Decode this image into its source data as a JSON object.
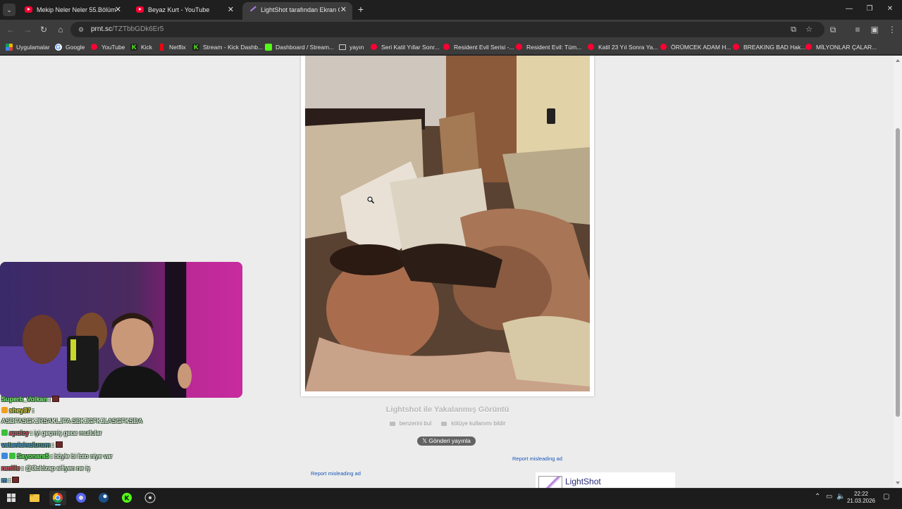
{
  "browser": {
    "tabs": [
      {
        "title": "Mekip Neler Neler 55.Bölüm BA",
        "favicon": "youtube-icon",
        "active": false
      },
      {
        "title": "Beyaz Kurt - YouTube",
        "favicon": "youtube-icon",
        "active": false
      },
      {
        "title": "LightShot tarafından Ekran Gör",
        "favicon": "lightshot-icon",
        "active": true
      }
    ],
    "address": {
      "host": "prnt.sc",
      "path": "/TZTbbGDk6Er5"
    },
    "bookmarks": [
      {
        "label": "Uygulamalar",
        "icon": "apps-grid-icon"
      },
      {
        "label": "Google",
        "icon": "google-icon"
      },
      {
        "label": "YouTube",
        "icon": "youtube-icon"
      },
      {
        "label": "Kick",
        "icon": "kick-icon"
      },
      {
        "label": "Netflix",
        "icon": "netflix-icon"
      },
      {
        "label": "Stream - Kick Dashb...",
        "icon": "kick-icon"
      },
      {
        "label": "Dashboard / Stream...",
        "icon": "streamlabs-icon"
      },
      {
        "label": "yayın",
        "icon": "folder-icon"
      },
      {
        "label": "Seri Katil Yıllar Sonr...",
        "icon": "youtube-icon"
      },
      {
        "label": "Resident Evil Serisi -...",
        "icon": "youtube-icon"
      },
      {
        "label": "Resident Evil: Tüm...",
        "icon": "youtube-icon"
      },
      {
        "label": "Katil 23 Yıl Sonra Ya...",
        "icon": "youtube-icon"
      },
      {
        "label": "ÖRÜMCEK ADAM H...",
        "icon": "youtube-icon"
      },
      {
        "label": "BREAKING BAD Hak...",
        "icon": "youtube-icon"
      },
      {
        "label": "MİLYONLAR ÇALAR...",
        "icon": "youtube-icon"
      }
    ]
  },
  "lightshot": {
    "caption": "Lightshot ile Yakalanmış Görüntü",
    "find_similar": "benzerini bul",
    "report_abuse": "kötüye kullanımı bildir",
    "tweet_button": "Gönderi yayınla",
    "report_ad_left": "Report misleading ad",
    "report_ad_right": "Report misleading ad",
    "ad_brand": "LightShot"
  },
  "chat": [
    {
      "user": "Superb_Volkan",
      "message": "",
      "color": "#7be07b",
      "badge": "",
      "emote": true
    },
    {
      "user": "shey37",
      "message": "",
      "color": "#f0c430",
      "badge": "#f0a020",
      "emote": false
    },
    {
      "user": "",
      "message": "ASDFASGKJRSAKLJFA SDKJGFKJLASGFKSDA",
      "color": "#ffffff",
      "badge": "",
      "emote": false
    },
    {
      "user": "apoizy",
      "message": "iyi geçmiş gece mutlular",
      "color": "#e0407a",
      "badge": "#3cc03c",
      "emote": false
    },
    {
      "user": "vatenicinolurum",
      "message": "",
      "color": "#4a90e2",
      "badge": "",
      "emote": true
    },
    {
      "user": "Sayonara5",
      "message": "böyle bi foto niye var",
      "color": "#5fe05f",
      "badge": "#3a8ae0",
      "emote": false
    },
    {
      "user": "renllle",
      "message": "@Coldzap sifiyen ne iş",
      "color": "#e0406a",
      "badge": "",
      "emote": false
    },
    {
      "user": "m",
      "message": "",
      "color": "#4a90e2",
      "badge": "",
      "emote": true
    }
  ],
  "system": {
    "time": "22:22",
    "date": "21.03.2026"
  }
}
